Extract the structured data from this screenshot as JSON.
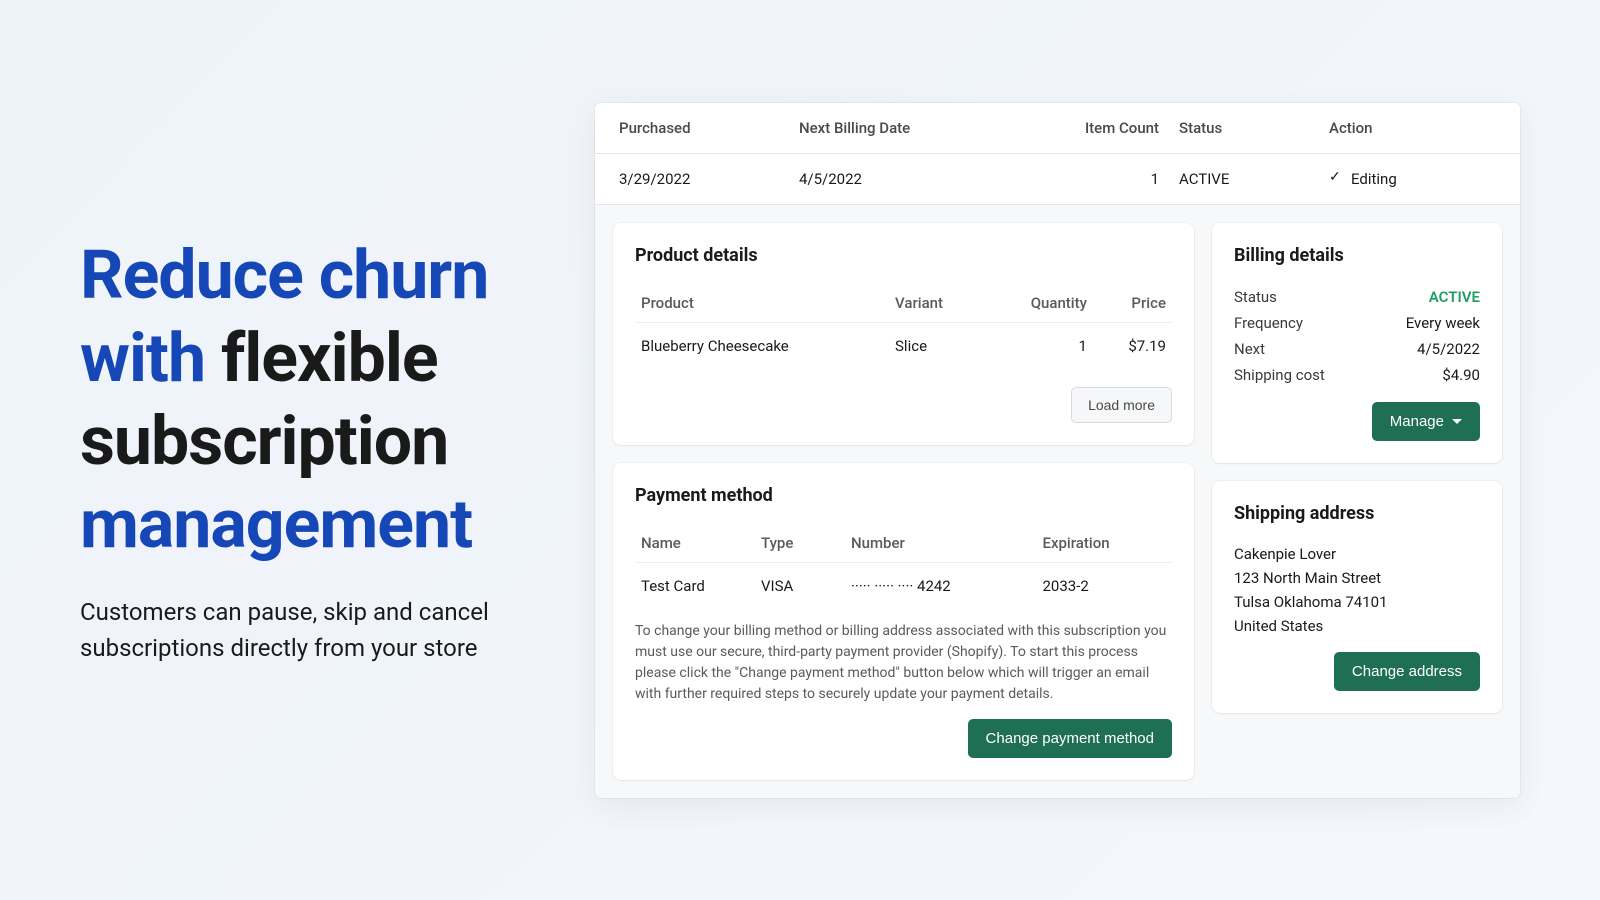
{
  "hero": {
    "h1_part1": "Reduce churn with",
    "h1_part2": "flexible subscription",
    "h1_part3": "management",
    "sub": "Customers can pause, skip and cancel subscriptions directly from your store"
  },
  "summary": {
    "headers": {
      "purchased": "Purchased",
      "next_billing": "Next Billing Date",
      "item_count": "Item Count",
      "status": "Status",
      "action": "Action"
    },
    "row": {
      "purchased": "3/29/2022",
      "next_billing": "4/5/2022",
      "item_count": "1",
      "status": "ACTIVE",
      "action": "Editing"
    }
  },
  "product": {
    "title": "Product details",
    "headers": {
      "product": "Product",
      "variant": "Variant",
      "quantity": "Quantity",
      "price": "Price"
    },
    "rows": [
      {
        "product": "Blueberry Cheesecake",
        "variant": "Slice",
        "quantity": "1",
        "price": "$7.19"
      }
    ],
    "load_more": "Load more"
  },
  "billing": {
    "title": "Billing details",
    "status_label": "Status",
    "status_value": "ACTIVE",
    "frequency_label": "Frequency",
    "frequency_value": "Every week",
    "next_label": "Next",
    "next_value": "4/5/2022",
    "shipping_label": "Shipping cost",
    "shipping_value": "$4.90",
    "manage": "Manage"
  },
  "payment": {
    "title": "Payment method",
    "headers": {
      "name": "Name",
      "type": "Type",
      "number": "Number",
      "expiration": "Expiration"
    },
    "row": {
      "name": "Test Card",
      "type": "VISA",
      "number": "····· ····· ···· 4242",
      "expiration": "2033-2"
    },
    "note": "To change your billing method or billing address associated with this subscription you must use our secure, third-party payment provider (Shopify). To start this process please click the \"Change payment method\" button below which will trigger an email with further required steps to securely update your payment details.",
    "button": "Change payment method"
  },
  "shipping": {
    "title": "Shipping address",
    "lines": [
      "Cakenpie Lover",
      "123 North Main Street",
      "Tulsa Oklahoma 74101",
      "United States"
    ],
    "button": "Change address"
  }
}
